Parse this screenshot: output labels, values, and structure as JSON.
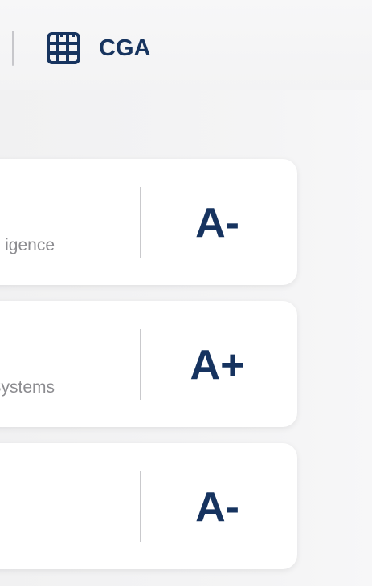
{
  "header": {
    "brand_label": "CGA",
    "icon": "grid-logo-icon"
  },
  "cards": [
    {
      "subtitle": "igence",
      "grade": "A-"
    },
    {
      "subtitle": "t Systems",
      "grade": "A+"
    },
    {
      "subtitle": "",
      "grade": "A-"
    }
  ],
  "colors": {
    "brand": "#17345f",
    "text_muted": "#8c8c90",
    "divider": "#c9c9cc",
    "card": "#ffffff",
    "background": "#f4f4f5"
  }
}
